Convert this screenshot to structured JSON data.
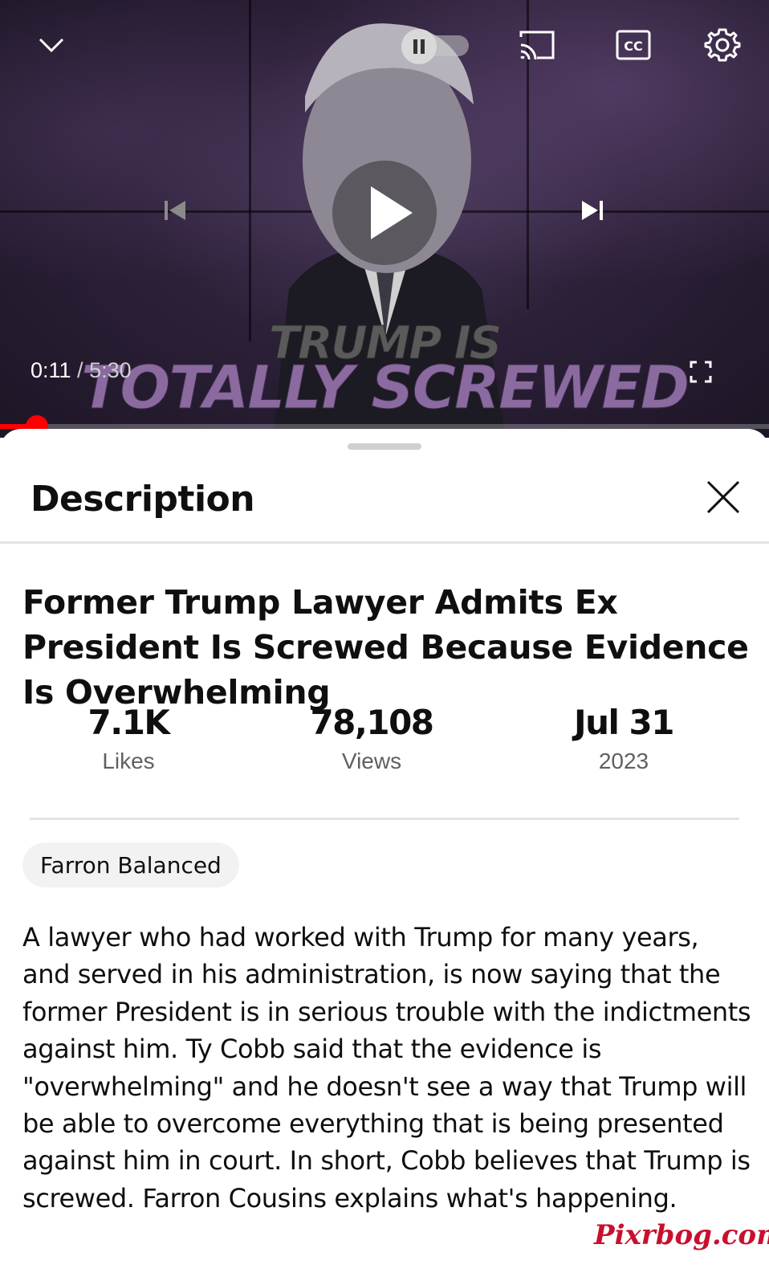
{
  "player": {
    "current_time": "0:11",
    "separator": " / ",
    "duration": "5:30",
    "overlay_line1": "TRUMP IS",
    "overlay_line2": "TOTALLY SCREWED",
    "progress_fraction": 0.033,
    "accent_color": "#ff0000",
    "icons": [
      "chevron-down-icon",
      "pause-icon",
      "cast-icon",
      "captions-icon",
      "settings-icon",
      "previous-icon",
      "play-icon",
      "next-icon",
      "fullscreen-icon"
    ]
  },
  "sheet": {
    "title": "Description",
    "close_icon": "close-icon"
  },
  "video": {
    "title": "Former Trump Lawyer Admits Ex President Is Screwed Because Evidence Is Overwhelming",
    "stats": [
      {
        "value": "7.1K",
        "label": "Likes"
      },
      {
        "value": "78,108",
        "label": "Views"
      },
      {
        "value": "Jul 31",
        "label": "2023"
      }
    ],
    "channel": "Farron Balanced",
    "description": "A lawyer who had worked with Trump for many years, and served in his administration, is now saying that the former President is in serious trouble with the indictments against him. Ty Cobb said that the evidence is \"overwhelming\" and he doesn't see a way that Trump will be able to overcome everything that is being presented against him in court. In short, Cobb believes that Trump is screwed. Farron Cousins explains what's happening."
  },
  "watermark": "Pixrbog.com"
}
